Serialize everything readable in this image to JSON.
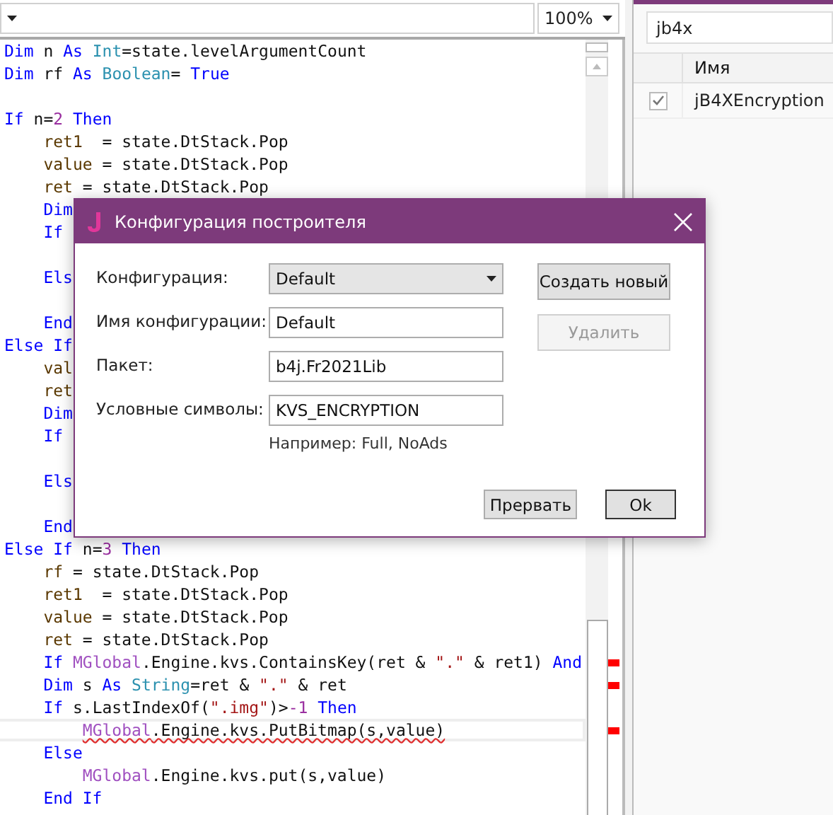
{
  "toolbar": {
    "zoom": "100%"
  },
  "editor": {
    "lines": [
      {
        "kind": "code",
        "marked": false,
        "tokens": [
          {
            "kind": "kw",
            "t": "Dim"
          },
          {
            "kind": "plain",
            "t": " n "
          },
          {
            "kind": "kw",
            "t": "As "
          },
          {
            "kind": "type",
            "t": "Int"
          },
          {
            "kind": "plain",
            "t": "=state.levelArgumentCount"
          }
        ]
      },
      {
        "kind": "code",
        "marked": false,
        "tokens": [
          {
            "kind": "kw",
            "t": "Dim"
          },
          {
            "kind": "plain",
            "t": " rf "
          },
          {
            "kind": "kw",
            "t": "As "
          },
          {
            "kind": "type",
            "t": "Boolean"
          },
          {
            "kind": "plain",
            "t": "= "
          },
          {
            "kind": "kw",
            "t": "True"
          }
        ]
      },
      {
        "kind": "blank",
        "marked": false
      },
      {
        "kind": "code",
        "marked": false,
        "tokens": [
          {
            "kind": "kw",
            "t": "If"
          },
          {
            "kind": "plain",
            "t": " n="
          },
          {
            "kind": "num",
            "t": "2 "
          },
          {
            "kind": "kw",
            "t": "Then"
          }
        ]
      },
      {
        "kind": "code",
        "marked": false,
        "tokens": [
          {
            "kind": "var",
            "t": "    ret1"
          },
          {
            "kind": "plain",
            "t": "  = state.DtStack.Pop"
          }
        ]
      },
      {
        "kind": "code",
        "marked": false,
        "tokens": [
          {
            "kind": "var",
            "t": "    value"
          },
          {
            "kind": "plain",
            "t": " = state.DtStack.Pop"
          }
        ]
      },
      {
        "kind": "code",
        "marked": false,
        "tokens": [
          {
            "kind": "var",
            "t": "    ret"
          },
          {
            "kind": "plain",
            "t": " = state.DtStack.Pop"
          }
        ]
      },
      {
        "kind": "code",
        "marked": false,
        "tokens": [
          {
            "kind": "kw",
            "t": "    Dim"
          }
        ]
      },
      {
        "kind": "code",
        "marked": false,
        "tokens": [
          {
            "kind": "kw",
            "t": "    If"
          }
        ]
      },
      {
        "kind": "blank",
        "marked": false
      },
      {
        "kind": "code",
        "marked": false,
        "tokens": [
          {
            "kind": "kw",
            "t": "    Els"
          }
        ]
      },
      {
        "kind": "blank",
        "marked": false
      },
      {
        "kind": "code",
        "marked": false,
        "tokens": [
          {
            "kind": "kw",
            "t": "    End"
          }
        ]
      },
      {
        "kind": "code",
        "marked": false,
        "tokens": [
          {
            "kind": "kw",
            "t": "Else If"
          }
        ]
      },
      {
        "kind": "code",
        "marked": false,
        "tokens": [
          {
            "kind": "var",
            "t": "    val"
          }
        ]
      },
      {
        "kind": "code",
        "marked": false,
        "tokens": [
          {
            "kind": "var",
            "t": "    ret"
          }
        ]
      },
      {
        "kind": "code",
        "marked": false,
        "tokens": [
          {
            "kind": "kw",
            "t": "    Dim"
          }
        ]
      },
      {
        "kind": "code",
        "marked": false,
        "tokens": [
          {
            "kind": "kw",
            "t": "    If"
          }
        ]
      },
      {
        "kind": "blank",
        "marked": false
      },
      {
        "kind": "code",
        "marked": false,
        "tokens": [
          {
            "kind": "kw",
            "t": "    Els"
          }
        ]
      },
      {
        "kind": "blank",
        "marked": false
      },
      {
        "kind": "code",
        "marked": false,
        "tokens": [
          {
            "kind": "kw",
            "t": "    End"
          }
        ]
      },
      {
        "kind": "code",
        "marked": false,
        "tokens": [
          {
            "kind": "kw",
            "t": "Else If"
          },
          {
            "kind": "plain",
            "t": " n="
          },
          {
            "kind": "num",
            "t": "3 "
          },
          {
            "kind": "kw",
            "t": "Then"
          }
        ]
      },
      {
        "kind": "code",
        "marked": false,
        "tokens": [
          {
            "kind": "var",
            "t": "    rf"
          },
          {
            "kind": "plain",
            "t": " = state.DtStack.Pop"
          }
        ]
      },
      {
        "kind": "code",
        "marked": false,
        "tokens": [
          {
            "kind": "var",
            "t": "    ret1"
          },
          {
            "kind": "plain",
            "t": "  = state.DtStack.Pop"
          }
        ]
      },
      {
        "kind": "code",
        "marked": false,
        "tokens": [
          {
            "kind": "var",
            "t": "    value"
          },
          {
            "kind": "plain",
            "t": " = state.DtStack.Pop"
          }
        ]
      },
      {
        "kind": "code",
        "marked": false,
        "tokens": [
          {
            "kind": "var",
            "t": "    ret"
          },
          {
            "kind": "plain",
            "t": " = state.DtStack.Pop"
          }
        ]
      },
      {
        "kind": "code",
        "marked": true,
        "tokens": [
          {
            "kind": "kw",
            "t": "    If "
          },
          {
            "kind": "global",
            "t": "MGlobal"
          },
          {
            "kind": "plain",
            "t": ".Engine.kvs.ContainsKey(ret & "
          },
          {
            "kind": "str",
            "t": "\".\""
          },
          {
            "kind": "plain",
            "t": " & ret1) "
          },
          {
            "kind": "kw",
            "t": "And"
          }
        ]
      },
      {
        "kind": "code",
        "marked": true,
        "tokens": [
          {
            "kind": "kw",
            "t": "    Dim"
          },
          {
            "kind": "plain",
            "t": " s "
          },
          {
            "kind": "kw",
            "t": "As "
          },
          {
            "kind": "type",
            "t": "String"
          },
          {
            "kind": "plain",
            "t": "=ret & "
          },
          {
            "kind": "str",
            "t": "\".\""
          },
          {
            "kind": "plain",
            "t": " & ret"
          }
        ]
      },
      {
        "kind": "code",
        "marked": false,
        "tokens": [
          {
            "kind": "kw",
            "t": "    If"
          },
          {
            "kind": "plain",
            "t": " s.LastIndexOf("
          },
          {
            "kind": "str",
            "t": "\".img\""
          },
          {
            "kind": "plain",
            "t": ")>"
          },
          {
            "kind": "num",
            "t": "-1 "
          },
          {
            "kind": "kw",
            "t": "Then"
          }
        ]
      },
      {
        "kind": "current",
        "marked": true,
        "tokens": [
          {
            "kind": "global",
            "t": "MGlobal"
          },
          {
            "kind": "plain",
            "t": ".Engine.kvs.PutBitmap(s,value)"
          }
        ]
      },
      {
        "kind": "code",
        "marked": false,
        "tokens": [
          {
            "kind": "kw",
            "t": "    Else"
          }
        ]
      },
      {
        "kind": "code",
        "marked": false,
        "tokens": [
          {
            "kind": "global",
            "t": "        MGlobal"
          },
          {
            "kind": "plain",
            "t": ".Engine.kvs.put(s,value)"
          }
        ]
      },
      {
        "kind": "code",
        "marked": false,
        "tokens": [
          {
            "kind": "kw",
            "t": "    End If"
          }
        ]
      }
    ]
  },
  "libraries": {
    "search": "jb4x",
    "columns": [
      "Имя"
    ],
    "rows": [
      {
        "name": "jB4XEncryption",
        "checked": true
      }
    ]
  },
  "dialog": {
    "title": "Конфигурация построителя",
    "fields": [
      {
        "label": "Конфигурация:",
        "kind": "combo",
        "value": "Default"
      },
      {
        "label": "Имя конфигурации:",
        "kind": "input",
        "value": "Default"
      },
      {
        "label": "Пакет:",
        "kind": "input",
        "value": "b4j.Fr2021Lib"
      },
      {
        "label": "Условные символы:",
        "kind": "input",
        "value": "KVS_ENCRYPTION"
      }
    ],
    "hint": "Например: Full, NoAds",
    "side_buttons": [
      {
        "label": "Создать новый",
        "disabled": false
      },
      {
        "label": "Удалить",
        "disabled": true
      }
    ],
    "footer_buttons": [
      {
        "label": "Прервать",
        "default": false
      },
      {
        "label": "Ok",
        "default": true
      }
    ]
  }
}
